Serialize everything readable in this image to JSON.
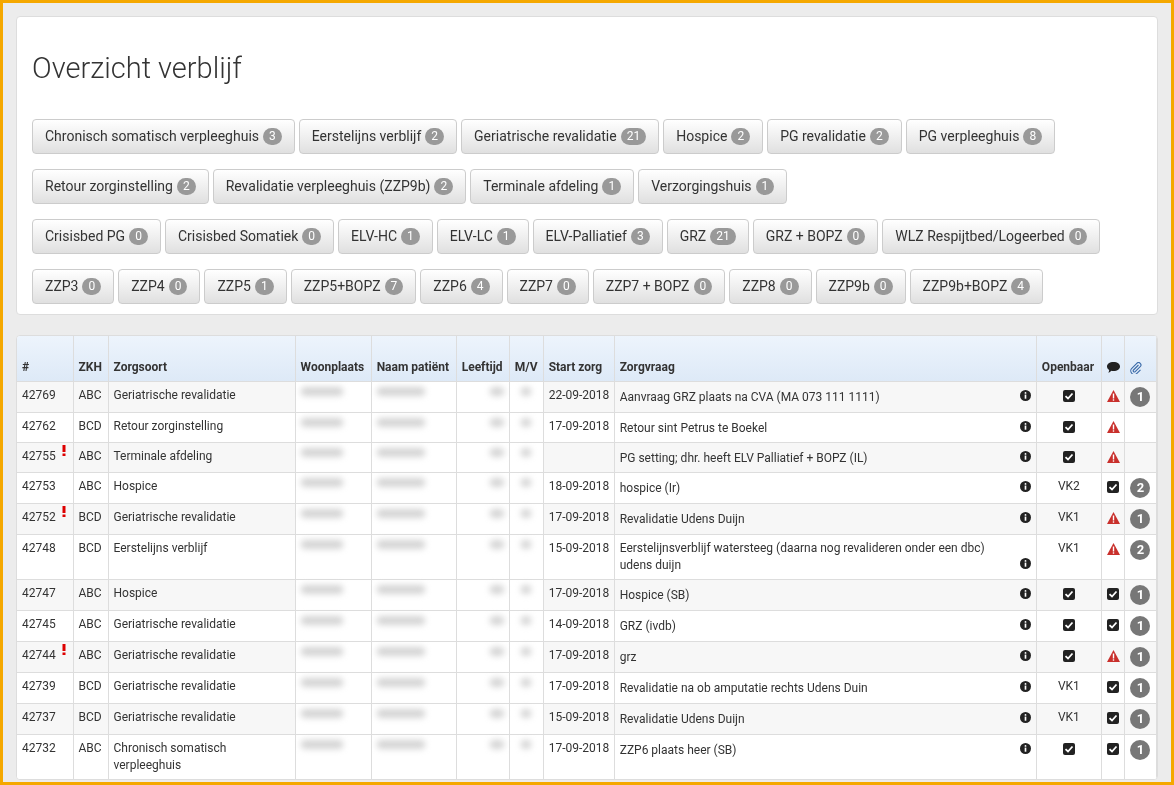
{
  "title": "Overzicht verblijf",
  "filter_rows": [
    [
      {
        "label": "Chronisch somatisch verpleeghuis",
        "count": "3"
      },
      {
        "label": "Eerstelijns verblijf",
        "count": "2"
      },
      {
        "label": "Geriatrische revalidatie",
        "count": "21"
      },
      {
        "label": "Hospice",
        "count": "2"
      },
      {
        "label": "PG revalidatie",
        "count": "2"
      },
      {
        "label": "PG verpleeghuis",
        "count": "8"
      }
    ],
    [
      {
        "label": "Retour zorginstelling",
        "count": "2"
      },
      {
        "label": "Revalidatie verpleeghuis (ZZP9b)",
        "count": "2"
      },
      {
        "label": "Terminale afdeling",
        "count": "1"
      },
      {
        "label": "Verzorgingshuis",
        "count": "1"
      }
    ],
    [
      {
        "label": "Crisisbed PG",
        "count": "0"
      },
      {
        "label": "Crisisbed Somatiek",
        "count": "0"
      },
      {
        "label": "ELV-HC",
        "count": "1"
      },
      {
        "label": "ELV-LC",
        "count": "1"
      },
      {
        "label": "ELV-Palliatief",
        "count": "3"
      },
      {
        "label": "GRZ",
        "count": "21"
      },
      {
        "label": "GRZ + BOPZ",
        "count": "0"
      },
      {
        "label": "WLZ Respijtbed/Logeerbed",
        "count": "0"
      }
    ],
    [
      {
        "label": "ZZP3",
        "count": "0"
      },
      {
        "label": "ZZP4",
        "count": "0"
      },
      {
        "label": "ZZP5",
        "count": "1"
      },
      {
        "label": "ZZP5+BOPZ",
        "count": "7"
      },
      {
        "label": "ZZP6",
        "count": "4"
      },
      {
        "label": "ZZP7",
        "count": "0"
      },
      {
        "label": "ZZP7 + BOPZ",
        "count": "0"
      },
      {
        "label": "ZZP8",
        "count": "0"
      },
      {
        "label": "ZZP9b",
        "count": "0"
      },
      {
        "label": "ZZP9b+BOPZ",
        "count": "4"
      }
    ]
  ],
  "table": {
    "columns": [
      "#",
      "ZKH",
      "Zorgsoort",
      "Woonplaats",
      "Naam patiënt",
      "Leeftijd",
      "M/V",
      "Start zorg",
      "Zorgvraag",
      "Openbaar"
    ],
    "rows": [
      {
        "id": "42769",
        "urgent": false,
        "zkh": "ABC",
        "zorgsoort": "Geriatrische revalidatie",
        "start": "22-09-2018",
        "zorgvraag": "Aanvraag GRZ plaats na CVA (MA 073 111 1111)",
        "openbaar": {
          "kind": "checkbox",
          "checked": true
        },
        "comment": {
          "kind": "warning"
        },
        "attachments": "1"
      },
      {
        "id": "42762",
        "urgent": false,
        "zkh": "BCD",
        "zorgsoort": "Retour zorginstelling",
        "start": "17-09-2018",
        "zorgvraag": "Retour sint Petrus te Boekel",
        "openbaar": {
          "kind": "checkbox",
          "checked": true
        },
        "comment": {
          "kind": "warning"
        }
      },
      {
        "id": "42755",
        "urgent": true,
        "zkh": "ABC",
        "zorgsoort": "Terminale afdeling",
        "zorgvraag": "PG setting; dhr. heeft ELV Palliatief + BOPZ (IL)",
        "openbaar": {
          "kind": "checkbox",
          "checked": true
        },
        "comment": {
          "kind": "warning"
        }
      },
      {
        "id": "42753",
        "urgent": false,
        "zkh": "ABC",
        "zorgsoort": "Hospice",
        "start": "18-09-2018",
        "zorgvraag": "hospice (Ir)",
        "openbaar": {
          "kind": "text",
          "text": "VK2"
        },
        "comment": {
          "kind": "checkbox",
          "checked": true
        },
        "attachments": "2"
      },
      {
        "id": "42752",
        "urgent": true,
        "zkh": "BCD",
        "zorgsoort": "Geriatrische revalidatie",
        "start": "17-09-2018",
        "zorgvraag": "Revalidatie Udens Duijn",
        "openbaar": {
          "kind": "text",
          "text": "VK1"
        },
        "comment": {
          "kind": "warning"
        },
        "attachments": "1"
      },
      {
        "id": "42748",
        "urgent": false,
        "zkh": "BCD",
        "zorgsoort": "Eerstelijns verblijf",
        "start": "15-09-2018",
        "zorgvraag": "Eerstelijnsverblijf watersteeg (daarna nog revalideren onder een dbc) udens duijn",
        "openbaar": {
          "kind": "text",
          "text": "VK1"
        },
        "comment": {
          "kind": "warning"
        },
        "attachments": "2"
      },
      {
        "id": "42747",
        "urgent": false,
        "zkh": "ABC",
        "zorgsoort": "Hospice",
        "start": "17-09-2018",
        "zorgvraag": "Hospice (SB)",
        "openbaar": {
          "kind": "checkbox",
          "checked": true
        },
        "comment": {
          "kind": "checkbox",
          "checked": true
        },
        "attachments": "1"
      },
      {
        "id": "42745",
        "urgent": false,
        "zkh": "ABC",
        "zorgsoort": "Geriatrische revalidatie",
        "start": "14-09-2018",
        "zorgvraag": "GRZ (ivdb)",
        "openbaar": {
          "kind": "checkbox",
          "checked": true
        },
        "comment": {
          "kind": "checkbox",
          "checked": true
        },
        "attachments": "1"
      },
      {
        "id": "42744",
        "urgent": true,
        "zkh": "ABC",
        "zorgsoort": "Geriatrische revalidatie",
        "start": "17-09-2018",
        "zorgvraag": "grz",
        "openbaar": {
          "kind": "checkbox",
          "checked": true
        },
        "comment": {
          "kind": "warning"
        },
        "attachments": "1"
      },
      {
        "id": "42739",
        "urgent": false,
        "zkh": "BCD",
        "zorgsoort": "Geriatrische revalidatie",
        "start": "17-09-2018",
        "zorgvraag": "Revalidatie na ob amputatie rechts Udens Duin",
        "openbaar": {
          "kind": "text",
          "text": "VK1"
        },
        "comment": {
          "kind": "checkbox",
          "checked": true
        },
        "attachments": "1"
      },
      {
        "id": "42737",
        "urgent": false,
        "zkh": "BCD",
        "zorgsoort": "Geriatrische revalidatie",
        "start": "15-09-2018",
        "zorgvraag": "Revalidatie Udens Duijn",
        "openbaar": {
          "kind": "text",
          "text": "VK1"
        },
        "comment": {
          "kind": "checkbox",
          "checked": true
        },
        "attachments": "1"
      },
      {
        "id": "42732",
        "urgent": false,
        "zkh": "ABC",
        "zorgsoort": "Chronisch somatisch verpleeghuis",
        "start": "17-09-2018",
        "zorgvraag": "ZZP6 plaats heer (SB)",
        "openbaar": {
          "kind": "checkbox",
          "checked": true
        },
        "comment": {
          "kind": "checkbox",
          "checked": true
        },
        "attachments": "1"
      }
    ]
  }
}
